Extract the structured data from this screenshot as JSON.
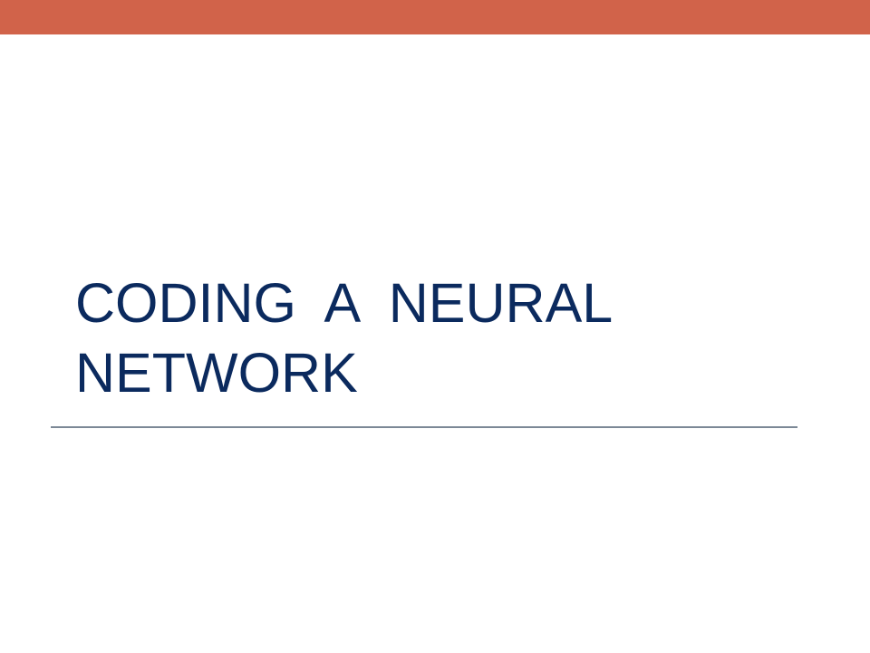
{
  "slide": {
    "title_lines": [
      "CODING  A  NEURAL",
      "NETWORK"
    ]
  },
  "colors": {
    "accent_bar": "#d1634a",
    "title_text": "#0b2a5e",
    "divider": "#7c8896",
    "background": "#ffffff"
  }
}
